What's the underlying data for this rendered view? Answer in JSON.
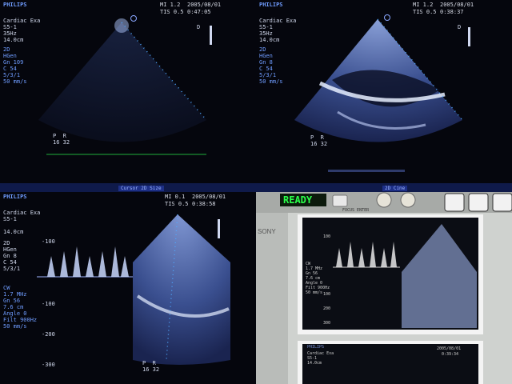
{
  "panel_tl": {
    "brand": "PHILIPS",
    "mi": "MI 1.2",
    "date": "2005/08/01",
    "tis": "TIS 0.5",
    "time": "0:47:05",
    "settings": [
      "Cardiac Exa",
      "S5-1",
      "35Hz",
      "14.0cm"
    ],
    "mode_block": [
      "2D",
      "HGen",
      "Gn 109",
      "C 54",
      "5/3/1",
      "50 mm/s"
    ],
    "marker": "D",
    "footer": "P  R\n16 32",
    "bottom_label": "Cursor  2D Size"
  },
  "panel_tr": {
    "brand": "PHILIPS",
    "mi": "MI 1.2",
    "date": "2005/08/01",
    "tis": "TIS 0.5",
    "time": "0:38:37",
    "settings": [
      "Cardiac Exa",
      "S5-1",
      "35Hz",
      "14.0cm"
    ],
    "mode_block": [
      "2D",
      "HGen",
      "Gn 8",
      "C 54",
      "5/3/1",
      "50 mm/s"
    ],
    "marker": "D",
    "footer": "P  R\n16 32",
    "bottom_label": "2D Cine"
  },
  "panel_bl": {
    "brand": "PHILIPS",
    "mi": "MI 0.1",
    "date": "2005/08/01",
    "tis": "TIS 0.5",
    "time": "0:38:58",
    "settings": [
      "Cardiac Exa",
      "S5-1",
      "",
      "14.0cm"
    ],
    "mode_block": [
      "2D",
      "HGen",
      "Gn 8",
      "C 54",
      "5/3/1"
    ],
    "cw_label": "CW",
    "cw_block": [
      "1.7 MHz",
      "Gn 56",
      "7.6 cm",
      "Angle 0",
      "Filt 900Hz",
      "50 mm/s"
    ],
    "scale_labels": [
      "-100",
      "-100",
      "-200",
      "-300"
    ],
    "footer": "P  R\n16 32"
  },
  "panel_br": {
    "display": "READY",
    "brand": "SONY",
    "button_label": "FOCUS ENTER",
    "print_header": [
      "PHILIPS",
      "Cardiac Exa",
      "S5-1",
      "14.0cm"
    ],
    "print_date": "2005/08/01",
    "print_time": "0:39:34",
    "print_cw": [
      "CW",
      "1.7 MHz",
      "Gn 56",
      "7.6 cm",
      "Angle 0",
      "Filt 900Hz",
      "50 mm/s"
    ],
    "print_scale": [
      "100",
      "100",
      "200",
      "300"
    ]
  },
  "colors": {
    "screen_bg": "#05060d",
    "ui_blue": "#6f9cff",
    "tissue": "#c9d8ff",
    "lcd_green": "#2aff4a",
    "printer_body": "#d9dcd9"
  }
}
